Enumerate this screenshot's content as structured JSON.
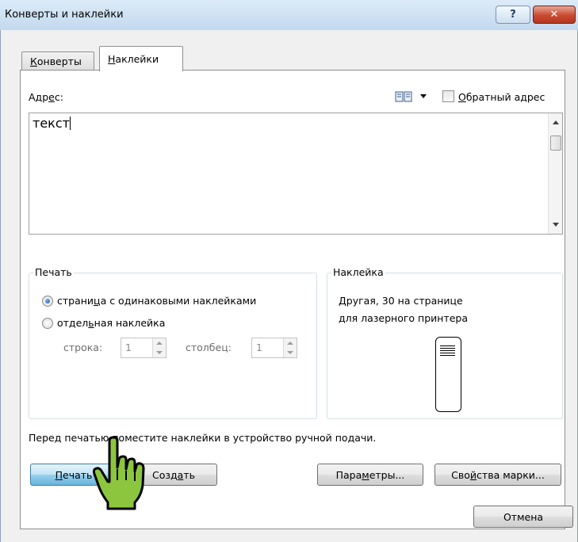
{
  "window": {
    "title": "Конверты и наклейки",
    "help_glyph": "?",
    "close_glyph": "✕"
  },
  "tabs": {
    "envelopes": {
      "pre": "",
      "key": "К",
      "post": "онверты"
    },
    "labels": {
      "pre": "",
      "key": "Н",
      "post": "аклейки"
    }
  },
  "address": {
    "label_pre": "Адр",
    "label_key": "е",
    "label_post": "с:",
    "book_icon": "address-book-icon",
    "return_checkbox": {
      "pre": "",
      "key": "О",
      "post": "братный адрес",
      "checked": false
    },
    "value": "текст"
  },
  "print_group": {
    "title": "Печать",
    "option_page": {
      "pre": "страни",
      "key": "ц",
      "post": "а с одинаковыми наклейками",
      "selected": true
    },
    "option_single": {
      "pre": "отдел",
      "key": "ь",
      "post": "ная наклейка",
      "selected": false
    },
    "row_label": "строка:",
    "row_value": "1",
    "col_label": "столбец:",
    "col_value": "1"
  },
  "label_group": {
    "title": "Наклейка",
    "line1": "Другая, 30 на странице",
    "line2": "для лазерного принтера"
  },
  "hint": "Перед печатью поместите наклейки в устройство ручной подачи.",
  "buttons": {
    "print": {
      "pre": "",
      "key": "П",
      "post": "ечать"
    },
    "create": {
      "pre": "Созд",
      "key": "а",
      "post": "ть"
    },
    "options": {
      "pre": "Пара",
      "key": "м",
      "post": "етры..."
    },
    "stamp": {
      "pre": "Сво",
      "key": "й",
      "post": "ства марки..."
    },
    "cancel": "Отмена"
  },
  "colors": {
    "cursor_fill": "#8cc63f",
    "default_button": "#98d1ef",
    "close_button": "#c8492f"
  }
}
